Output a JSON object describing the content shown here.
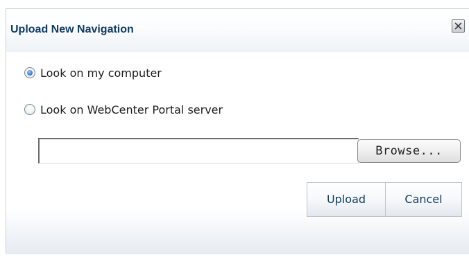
{
  "dialog": {
    "title": "Upload New Navigation",
    "close_icon": "close-x-icon"
  },
  "options": [
    {
      "label": "Look on my computer",
      "selected": true
    },
    {
      "label": "Look on WebCenter Portal server",
      "selected": false
    }
  ],
  "file_input": {
    "value": "",
    "placeholder": ""
  },
  "buttons": {
    "browse_label": "Browse...",
    "upload_label": "Upload",
    "cancel_label": "Cancel"
  },
  "colors": {
    "title_text": "#0f3b5f",
    "button_text": "#0f3b5f",
    "radio_selected": "#3d7fd6",
    "button_border": "#b9c4cf"
  }
}
